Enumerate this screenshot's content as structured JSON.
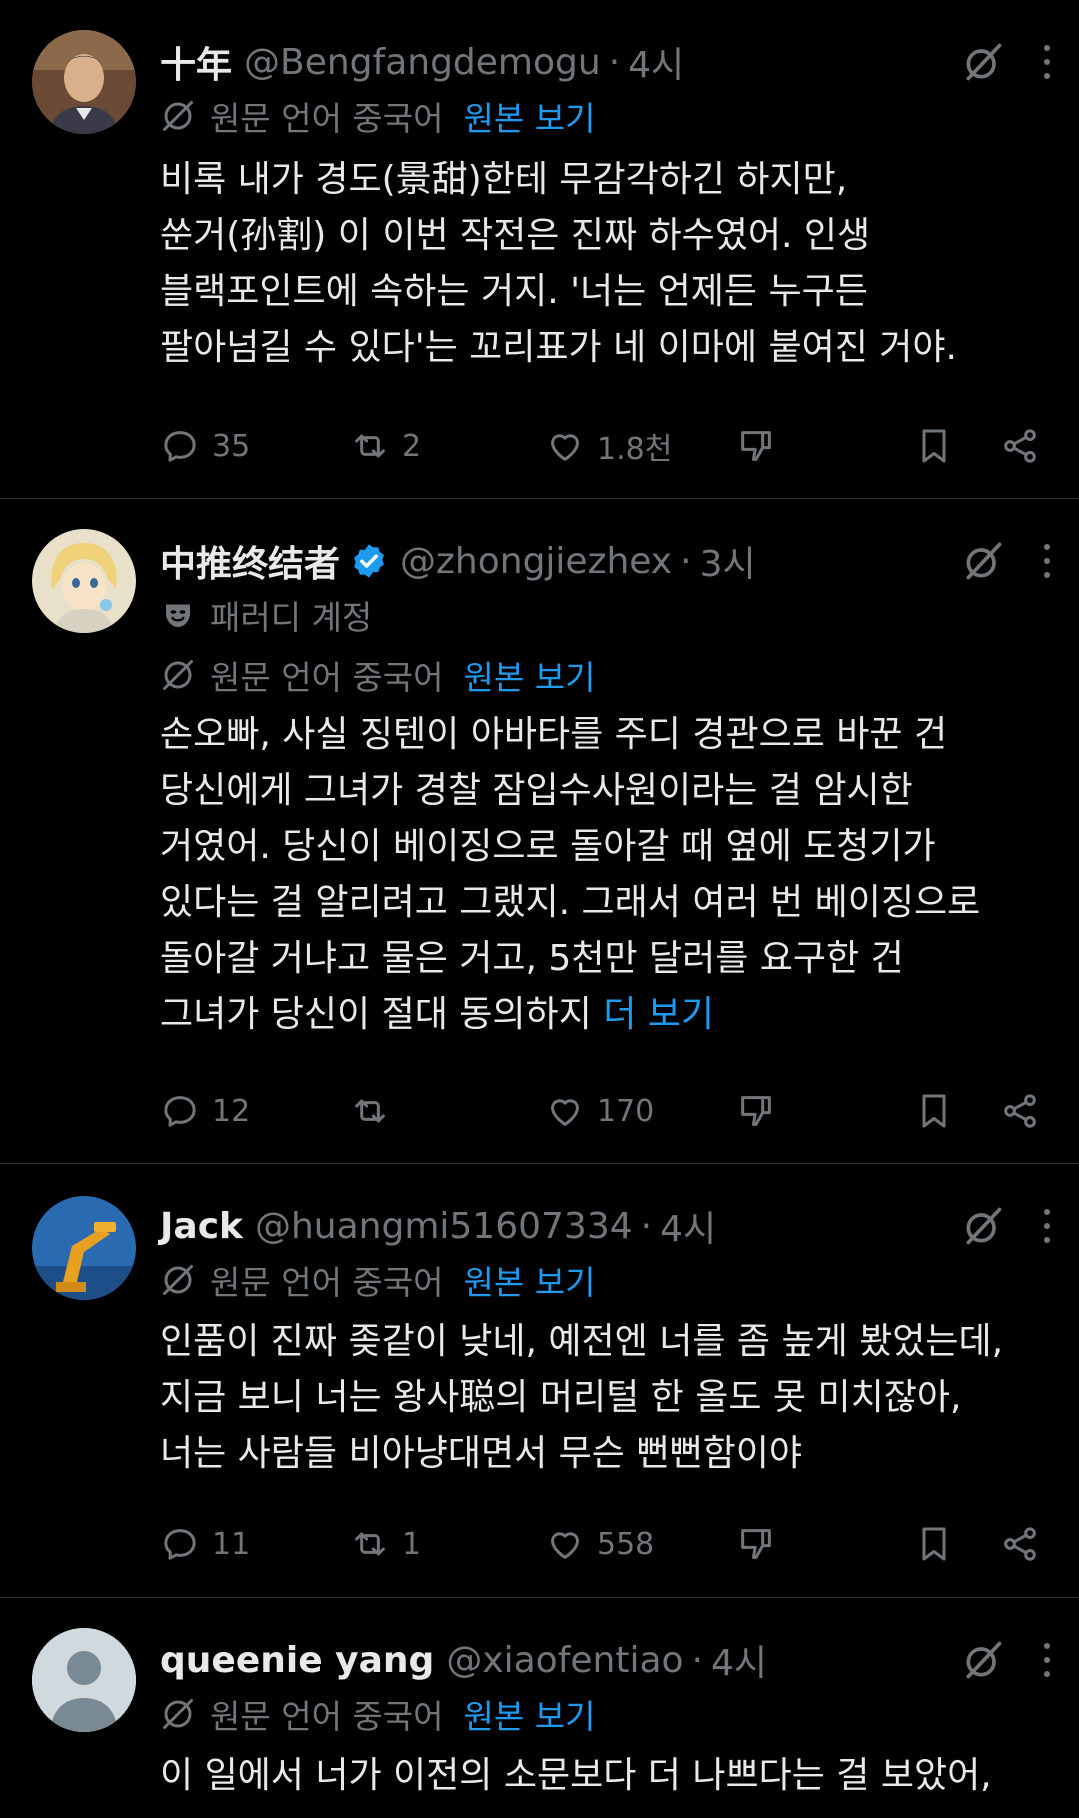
{
  "tweets": [
    {
      "name": "十年",
      "handle": "@Bengfangdemogu",
      "dot": "·",
      "time": "4시",
      "translate_label": "원문 언어 중국어",
      "show_original": "원본 보기",
      "lines": [
        "비록 내가 경도(景甜)한테 무감각하긴 하지만,",
        "쑨거(孙割) 이 이번 작전은 진짜 하수였어. 인생",
        "블랙포인트에 속하는 거지. '너는 언제든 누구든",
        "팔아넘길 수 있다'는 꼬리표가 네 이마에 붙여진 거야."
      ],
      "replies": "35",
      "reposts": "2",
      "likes": "1.8천"
    },
    {
      "name": "中推终结者",
      "handle": "@zhongjiezhex",
      "dot": "·",
      "time": "3시",
      "parody_label": "패러디 계정",
      "translate_label": "원문 언어 중국어",
      "show_original": "원본 보기",
      "lines": [
        "손오빠, 사실 징텐이 아바타를 주디 경관으로 바꾼 건",
        "당신에게 그녀가 경찰 잠입수사원이라는 걸 암시한",
        "거였어. 당신이 베이징으로 돌아갈 때 옆에 도청기가",
        "있다는 걸 알리려고 그랬지. 그래서 여러 번 베이징으로",
        "돌아갈 거냐고 물은 거고, 5천만 달러를 요구한 건",
        "그녀가 당신이 절대 동의하지 "
      ],
      "more": "더 보기",
      "replies": "12",
      "reposts": "",
      "likes": "170"
    },
    {
      "name": "Jack",
      "handle": "@huangmi51607334",
      "dot": "·",
      "time": "4시",
      "translate_label": "원문 언어 중국어",
      "show_original": "원본 보기",
      "lines": [
        "인품이 진짜 좆같이 낮네, 예전엔 너를 좀 높게 봤었는데,",
        "지금 보니 너는 왕사聪의 머리털 한 올도 못 미치잖아,",
        "너는 사람들 비아냥대면서 무슨 뻔뻔함이야"
      ],
      "replies": "11",
      "reposts": "1",
      "likes": "558"
    },
    {
      "name": "queenie yang",
      "handle": "@xiaofentiao",
      "dot": "·",
      "time": "4시",
      "translate_label": "원문 언어 중국어",
      "show_original": "원본 보기",
      "lines": [
        "이 일에서 너가 이전의 소문보다 더 나쁘다는 걸 보았어,"
      ]
    }
  ],
  "colors": {
    "background": "#000000",
    "text": "#e7e9ea",
    "muted": "#71767b",
    "link": "#1d9bf0",
    "divider": "#2f3336"
  },
  "icons": [
    "grok-icon",
    "more-icon",
    "translate-icon",
    "reply-icon",
    "repost-icon",
    "like-icon",
    "dislike-icon",
    "bookmark-icon",
    "share-icon",
    "verified-badge-icon",
    "parody-mask-icon"
  ]
}
